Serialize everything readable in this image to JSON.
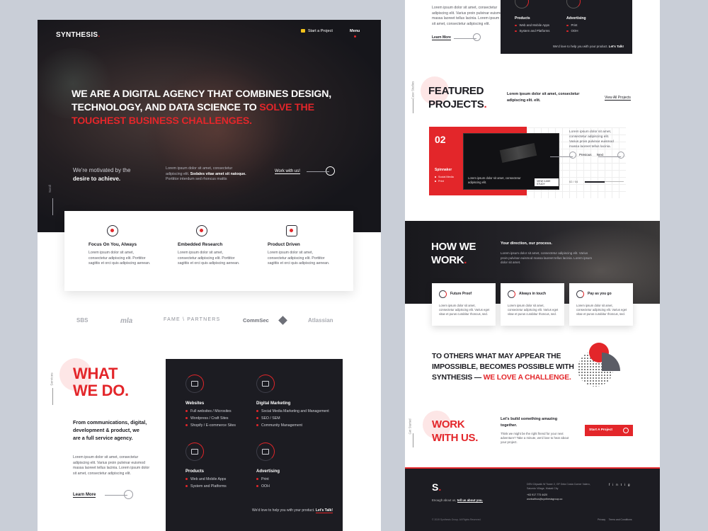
{
  "brand": "SYNTHESIS",
  "brand_dot": ".",
  "nav": {
    "start_project": "Start a Project",
    "menu": "Menu"
  },
  "hero": {
    "line1": "WE ARE A DIGITAL AGENCY THAT COMBINES DESIGN,",
    "line2a": "TECHNOLOGY, AND DATA SCIENCE TO ",
    "line2b": "SOLVE THE",
    "line3": "TOUGHEST BUSINESS CHALLENGES.",
    "motivated_a": "We're motivated by the",
    "motivated_b": "desire to achieve.",
    "para_a": "Lorem ipsum dolor sit amet, consectetur",
    "para_b": "adipiscing elit.",
    "para_bold": "Sodales vitae amet sit natoque.",
    "para_c": "Porttitor interdum sed rhoncus mattis",
    "cta": "Work with us!",
    "scroll": "Scroll"
  },
  "features": [
    {
      "title": "Focus On You, Always",
      "icon": "people-icon",
      "l1": "Lorem ipsum dolor sit amet,",
      "l2": "consectetur adipiscing elit. Porttitor",
      "l3": "sagittis et orci quis adipiscing aenean."
    },
    {
      "title": "Embedded Research",
      "icon": "magnifier-icon",
      "l1": "Lorem ipsum dolor sit amet,",
      "l2": "consectetur adipiscing elit. Porttitor",
      "l3": "sagittis et orci quis adipiscing aenean."
    },
    {
      "title": "Product Driven",
      "icon": "product-icon",
      "l1": "Lorem ipsum dolor sit amet,",
      "l2": "consectetur adipiscing elit. Porttitor",
      "l3": "sagittis et orci quis adipiscing aenean."
    }
  ],
  "partners": [
    "SBS",
    "mla",
    "FAME \\ PARTNERS",
    "CommSec",
    "Atlassian"
  ],
  "services": {
    "label": "Services",
    "title1": "WHAT",
    "title2": "WE DO.",
    "lead1": "From communications, digital,",
    "lead2": "development & product, we",
    "lead3": "are a full service agency.",
    "p1": "Lorem ipsum dolor sit amet, consectetur",
    "p2": "adipiscing elit. Varius proin pulvinar euismod",
    "p3": "massa laoreet tellus lacinia. Lorem ipsum dolor",
    "p4": "sit amet, consectetur adipiscing elit.",
    "learn_more": "Learn More",
    "categories": [
      {
        "name": "Websites",
        "icon": "browser-icon",
        "items": [
          "Full websites / Microsites",
          "Wordpress / Craft Sites",
          "Shopify / E-commerce Sites"
        ]
      },
      {
        "name": "Digital Marketing",
        "icon": "megaphone-icon",
        "items": [
          "Social Media Marketing and Management",
          "SEO / SEM",
          "Community Management"
        ]
      },
      {
        "name": "Products",
        "icon": "device-icon",
        "items": [
          "Web and Mobile Apps",
          "System and Platforms"
        ]
      },
      {
        "name": "Advertising",
        "icon": "billboard-icon",
        "items": [
          "Print",
          "OOH"
        ]
      }
    ],
    "help": "We'd love to help you with your product.",
    "help_cta": "Let's Talk!"
  },
  "top_r": {
    "p1": "Lorem ipsum dolor sit amet, consectetur",
    "p2": "adipiscing elit. Varius proin pulvinar euismod",
    "p3": "massa laoreet tellus lacinia. Lorem ipsum dolor",
    "p4": "sit amet, consectetur adipiscing elit.",
    "learn_more": "Learn More",
    "products": "Products",
    "products_items": [
      "Web and Mobile Apps",
      "System and Platforms"
    ],
    "advertising": "Advertising",
    "advertising_items": [
      "Print",
      "OOH"
    ],
    "help": "We'd love to help you with your product.",
    "help_cta": "Let's Talk!"
  },
  "featured": {
    "label": "Case Studies",
    "title1": "FEATURED",
    "title2": "PROJECTS",
    "lead1": "Lorem ipsum dolor sit amet, consectetur",
    "lead2": "adipiscing elit. elit.",
    "view_all": "View All Projects",
    "number": "02",
    "project": "Spinnaker",
    "tags": [
      "Social Media",
      "Print"
    ],
    "screen_text": "Lorem ipsum dolor sit amet, consectetur adipiscing elit.",
    "screen_cta": "VIEW CASE STUDY",
    "side1": "Lorem ipsum dolor sit amet,",
    "side2": "consectetur adipiscing elit.",
    "side3": "Varius proin pulvinar euismod",
    "side4": "massa laoreet tellus lacinia.",
    "previous": "Previous",
    "next": "Next",
    "counter": "02 / 04"
  },
  "how": {
    "title1": "HOW WE",
    "title2": "WORK",
    "sub": "Your direction, our process.",
    "p1": "Lorem ipsum dolor sit amet, consectetur adipiscing elit. Varius proin pulvinar",
    "p2": "euismod massa laoreet tellus lacinia. Lorem ipsum dolor sit amet.",
    "cards": [
      {
        "title": "Future Proof",
        "icon": "shield-icon"
      },
      {
        "title": "Always in touch",
        "icon": "handshake-icon"
      },
      {
        "title": "Pay as you go",
        "icon": "hand-coin-icon"
      }
    ],
    "card_l1": "Lorem ipsum dolor sit amet,",
    "card_l2": "consectetur adipiscing elit. Varius eget",
    "card_l3": "vitae et purus curabitur rhoncus, sed."
  },
  "quote": {
    "l1": "TO OTHERS WHAT MAY APPEAR THE",
    "l2": "IMPOSSIBLE, BECOMES POSSIBLE WITH",
    "l3a": "SYNTHESIS — ",
    "l3b": "WE LOVE A CHALLENGE."
  },
  "work": {
    "label": "Get Started",
    "title1": "WORK",
    "title2": "WITH US.",
    "lead1": "Let's build something amazing",
    "lead2": "together.",
    "p1": "Think we might be the right friend for your next",
    "p2": "adventure? Take a minute, we'd love to hear about",
    "p3": "your project.",
    "cta": "Start A Project"
  },
  "footer": {
    "logo": "S",
    "enough": "Enough about us,",
    "tell": "tell us about you.",
    "addr1": "DEN Citywalk W Tower 2, GF Dela Costa Corner Valero,",
    "addr2": "Salcedo Village, Makati City",
    "phone": "+63 917 773 4420",
    "email": "workwithus@synthesisgroup.co",
    "copyright": "© 2019 Synthesis Group. All Rights Reserved.",
    "privacy": "Privacy",
    "terms": "Terms and Conditions",
    "social": [
      "f",
      "in",
      "t",
      "ig"
    ]
  }
}
